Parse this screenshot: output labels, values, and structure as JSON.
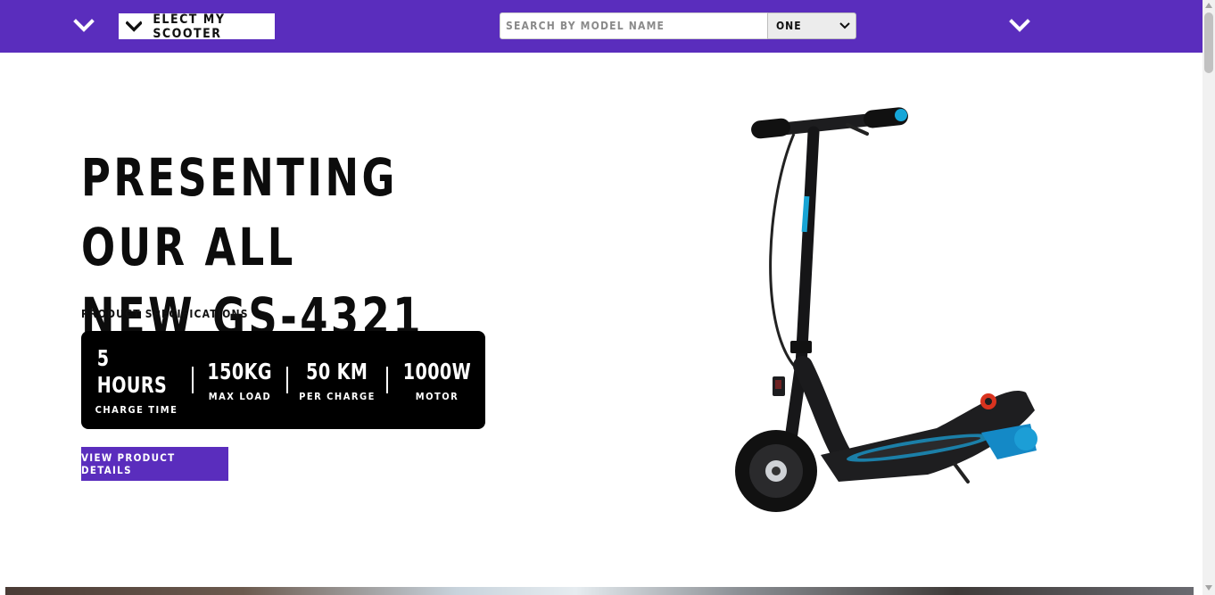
{
  "header": {
    "brand_label": "ELECT MY SCOOTER",
    "search_placeholder": "SEARCH BY MODEL NAME",
    "select_value": "ONE",
    "accent_color": "#5a2dbd"
  },
  "hero": {
    "title_line1": "PRESENTING OUR ALL",
    "title_line2": "NEW GS-4321",
    "spec_heading": "PRODUCT SPECIFICATIONS",
    "specs": [
      {
        "value": "5 HOURS",
        "caption": "CHARGE TIME"
      },
      {
        "value": "150KG",
        "caption": "MAX LOAD"
      },
      {
        "value": "50 KM",
        "caption": "PER CHARGE"
      },
      {
        "value": "1000W",
        "caption": "MOTOR"
      }
    ],
    "cta_label": "VIEW PRODUCT DETAILS"
  },
  "icons": {
    "nav_left": "chevron-down-icon",
    "nav_right": "chevron-down-icon",
    "brand": "chevron-down-icon",
    "select": "caret-down-icon"
  }
}
